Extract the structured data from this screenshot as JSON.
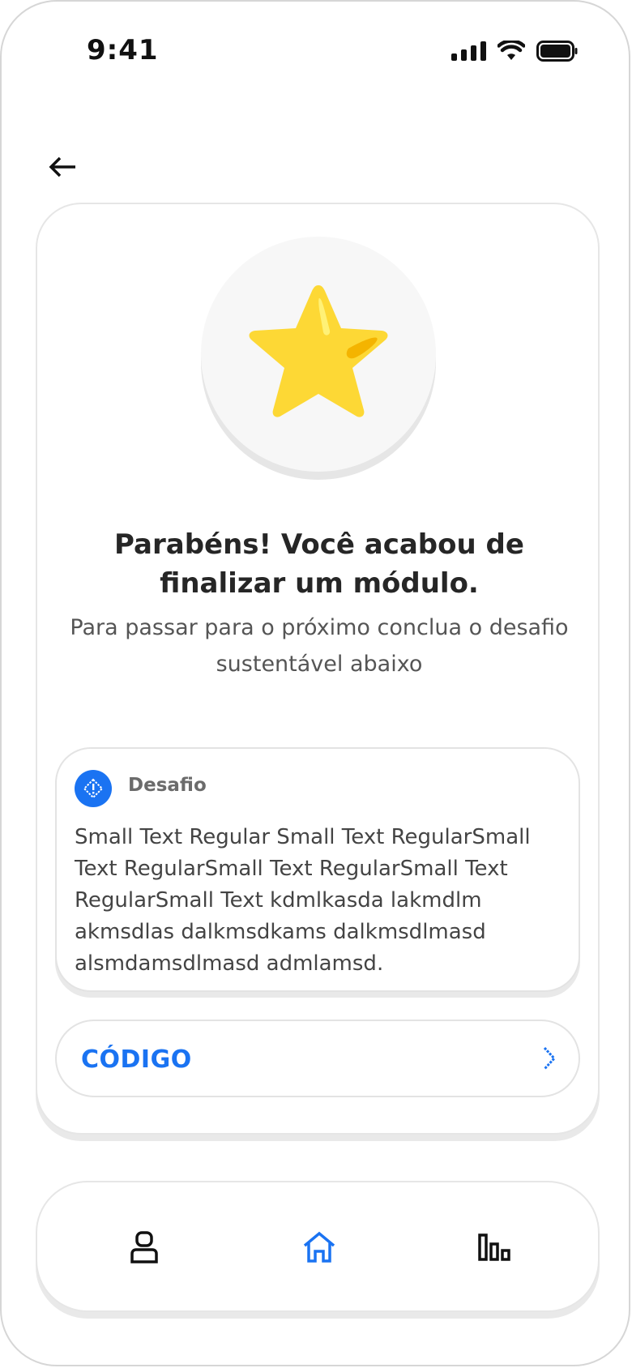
{
  "status_bar": {
    "time": "9:41",
    "icons": [
      "cellular-signal-icon",
      "wifi-icon",
      "battery-icon"
    ]
  },
  "header": {
    "back_icon": "arrow-left-icon"
  },
  "completion": {
    "badge_icon": "star-icon",
    "headline": "Parabéns! Você acabou de finalizar um módulo.",
    "subtitle": "Para passar para o próximo conclua o desafio sustentável abaixo"
  },
  "challenge": {
    "icon": "diamond-alert-icon",
    "title": "Desafio",
    "text": "Small Text Regular Small Text RegularSmall Text RegularSmall Text RegularSmall Text RegularSmall Text kdmlkasda lakmdlm akmsdlas dalkmsdkams dalkmsdlmasd alsmdamsdlmasd admlamsd."
  },
  "code_button": {
    "label": "CÓDIGO",
    "icon": "chevron-right-icon"
  },
  "bottom_nav": {
    "items": [
      {
        "icon": "profile-icon",
        "active": false
      },
      {
        "icon": "home-icon",
        "active": true
      },
      {
        "icon": "stats-icon",
        "active": false
      }
    ]
  },
  "colors": {
    "accent": "#1a73f2",
    "star": "#fdd835",
    "star_highlight": "#fff176",
    "star_shade": "#f4b400",
    "text_dark": "#262626",
    "text_muted": "#555555"
  }
}
